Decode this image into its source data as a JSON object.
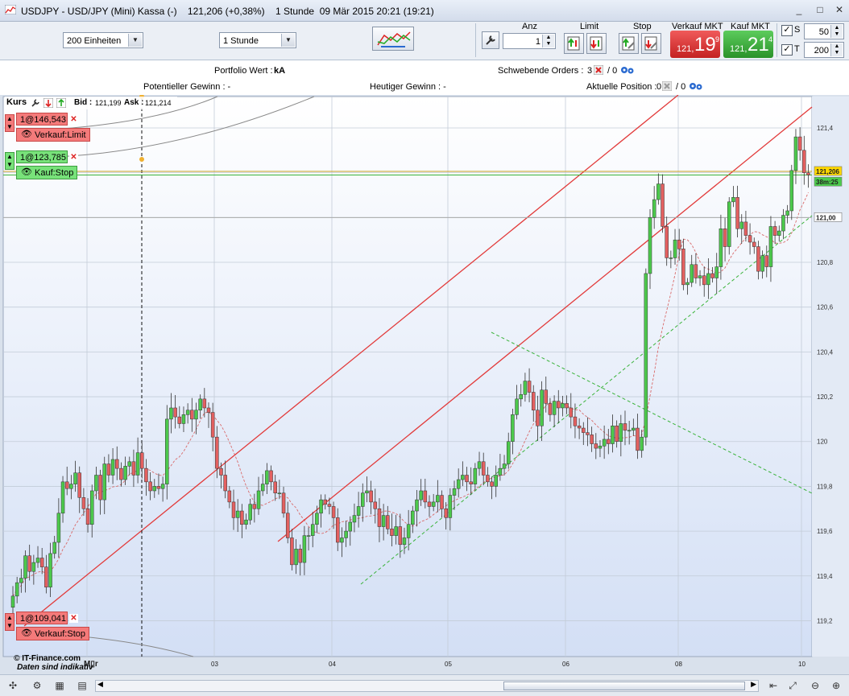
{
  "window": {
    "title": "USDJPY - USD/JPY (Mini) Kassa (-)    121,206 (+0,38%)    1 Stunde  09 Mär 2015 20:21 (19:21)",
    "minimize": "_",
    "maximize": "□",
    "close": "✕"
  },
  "toolbar": {
    "units_select": "200 Einheiten",
    "interval_select": "1 Stunde",
    "anz_label": "Anz",
    "anz_value": "1",
    "limit_label": "Limit",
    "stop_label": "Stop",
    "sell_label": "Verkauf MKT",
    "sell_small": "121,",
    "sell_big": "19",
    "sell_sup": "9",
    "buy_label": "Kauf MKT",
    "buy_small": "121,",
    "buy_big": "21",
    "buy_sup": "4",
    "s_label": "S",
    "s_value": "50",
    "t_label": "T",
    "t_value": "200",
    "colors": {
      "sell": "#e03a3a",
      "buy": "#3aa83a"
    }
  },
  "info": {
    "portfolio_label": "Portfolio Wert : ",
    "portfolio_value": "kA",
    "pending_label": "Schwebende Orders : ",
    "pending_a": "3",
    "pending_b": "/ 0",
    "potential_label": "Potentieller Gewinn : -",
    "today_label": "Heutiger Gewinn : -",
    "position_label": "Aktuelle Position : ",
    "position_a": "0",
    "position_b": "/ 0"
  },
  "chart_header": {
    "kurs": "Kurs",
    "bid_label": "Bid :",
    "bid_value": "121,199",
    "ask_label": "Ask :",
    "ask_value": "121,214"
  },
  "orders": [
    {
      "price": "1@146,543",
      "action": "Verkauf:Limit",
      "kind": "red"
    },
    {
      "price": "1@123,785",
      "action": "Kauf:Stop",
      "kind": "green"
    },
    {
      "price": "1@109,041",
      "action": "Verkauf:Stop",
      "kind": "red"
    }
  ],
  "footer": {
    "brand": "© IT-Finance.com",
    "note": "Daten sind indikativ"
  },
  "chart_data": {
    "type": "candlestick",
    "symbol": "USDJPY",
    "ylim": [
      119.04,
      121.54
    ],
    "y_ticks": [
      "121,4",
      "121,2",
      "121",
      "120,8",
      "120,6",
      "120,4",
      "120,2",
      "120",
      "119,8",
      "119,6",
      "119,4",
      "119,2"
    ],
    "y_tick_values": [
      121.4,
      121.2,
      121.0,
      120.8,
      120.6,
      120.4,
      120.2,
      120.0,
      119.8,
      119.6,
      119.4,
      119.2
    ],
    "x_ticks": [
      "M▯r",
      "03",
      "04",
      "05",
      "06",
      "08",
      "10"
    ],
    "price_tags": [
      {
        "label": "121,206",
        "value": 121.206,
        "color": "#ffd800"
      },
      {
        "label": "38m:25",
        "value": 121.18,
        "color": "#4ccc4c"
      },
      {
        "label": "121,00",
        "value": 121.0,
        "color": "#ffffff"
      }
    ],
    "colors": {
      "up": "#4cc94c",
      "down": "#e36060",
      "bg_top": "#ffffff",
      "bg_bottom": "#d3dff5"
    },
    "closes": [
      119.31,
      119.37,
      119.39,
      119.49,
      119.42,
      119.46,
      119.48,
      119.44,
      119.35,
      119.5,
      119.55,
      119.68,
      119.82,
      119.79,
      119.81,
      119.86,
      119.75,
      119.7,
      119.63,
      119.78,
      119.85,
      119.74,
      119.9,
      119.85,
      119.92,
      119.88,
      119.83,
      119.89,
      119.91,
      119.85,
      119.95,
      119.88,
      119.82,
      119.78,
      119.8,
      119.79,
      119.81,
      120.1,
      120.15,
      120.11,
      120.08,
      120.12,
      120.14,
      120.1,
      120.14,
      120.19,
      120.15,
      120.13,
      120.02,
      119.88,
      119.85,
      119.78,
      119.73,
      119.66,
      119.69,
      119.63,
      119.65,
      119.72,
      119.7,
      119.78,
      119.81,
      119.87,
      119.82,
      119.77,
      119.77,
      119.68,
      119.57,
      119.45,
      119.52,
      119.46,
      119.58,
      119.58,
      119.63,
      119.68,
      119.74,
      119.72,
      119.71,
      119.66,
      119.55,
      119.57,
      119.6,
      119.64,
      119.67,
      119.71,
      119.77,
      119.78,
      119.73,
      119.7,
      119.62,
      119.67,
      119.61,
      119.58,
      119.62,
      119.54,
      119.57,
      119.63,
      119.69,
      119.74,
      119.78,
      119.73,
      119.71,
      119.73,
      119.76,
      119.7,
      119.66,
      119.76,
      119.79,
      119.83,
      119.85,
      119.82,
      119.81,
      119.88,
      119.91,
      119.85,
      119.82,
      119.8,
      119.85,
      119.88,
      119.9,
      120.0,
      120.12,
      120.19,
      120.21,
      120.27,
      120.22,
      120.14,
      120.07,
      120.23,
      120.17,
      120.12,
      120.18,
      120.15,
      120.17,
      120.15,
      120.11,
      120.07,
      120.06,
      120.04,
      120.03,
      119.99,
      119.97,
      119.98,
      120.01,
      119.99,
      120.07,
      120.0,
      120.08,
      120.05,
      120.05,
      120.06,
      119.96,
      120.02,
      120.75,
      121.0,
      121.08,
      121.15,
      120.96,
      120.82,
      120.82,
      120.9,
      120.86,
      120.7,
      120.71,
      120.79,
      120.73,
      120.74,
      120.7,
      120.75,
      120.73,
      120.78,
      120.95,
      120.87,
      121.07,
      121.09,
      120.95,
      120.98,
      120.92,
      120.89,
      120.87,
      120.76,
      120.83,
      120.78,
      120.96,
      120.92,
      120.94,
      121.01,
      121.03,
      121.21,
      121.36,
      121.3,
      121.2,
      121.19
    ]
  }
}
